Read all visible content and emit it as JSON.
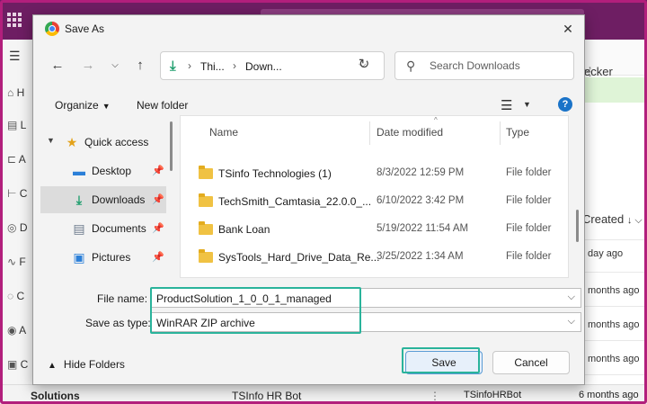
{
  "background": {
    "rail_items": [
      "H",
      "L",
      "A",
      "C",
      "D",
      "F",
      "C",
      "A",
      "C"
    ],
    "command_text": "ecker",
    "created_label": "Created",
    "rows": [
      "day ago",
      "months ago",
      "months ago",
      "months ago",
      "months ago"
    ],
    "bottom": {
      "solutions": "Solutions",
      "bot_name": "TSInfo HR Bot",
      "bot_id": "TSinfoHRBot",
      "age": "6 months ago"
    }
  },
  "dialog": {
    "title": "Save As",
    "address": {
      "crumb1": "Thi...",
      "crumb2": "Down..."
    },
    "search_placeholder": "Search Downloads",
    "toolbar": {
      "organize": "Organize",
      "new_folder": "New folder",
      "help": "?"
    },
    "nav": [
      {
        "label": "Quick access",
        "icon": "star-icon"
      },
      {
        "label": "Desktop",
        "icon": "desktop-icon"
      },
      {
        "label": "Downloads",
        "icon": "download-icon",
        "selected": true
      },
      {
        "label": "Documents",
        "icon": "documents-icon"
      },
      {
        "label": "Pictures",
        "icon": "pictures-icon"
      }
    ],
    "columns": {
      "name": "Name",
      "date": "Date modified",
      "type": "Type"
    },
    "files": [
      {
        "name": "TSinfo Technologies (1)",
        "date": "8/3/2022 12:59 PM",
        "type": "File folder"
      },
      {
        "name": "TechSmith_Camtasia_22.0.0_...",
        "date": "6/10/2022 3:42 PM",
        "type": "File folder"
      },
      {
        "name": "Bank Loan",
        "date": "5/19/2022 11:54 AM",
        "type": "File folder"
      },
      {
        "name": "SysTools_Hard_Drive_Data_Re...",
        "date": "3/25/2022 1:34 AM",
        "type": "File folder"
      }
    ],
    "file_name_label": "File name:",
    "file_name_value": "ProductSolution_1_0_0_1_managed",
    "save_type_label": "Save as type:",
    "save_type_value": "WinRAR ZIP archive",
    "hide_folders": "Hide Folders",
    "save_button": "Save",
    "cancel_button": "Cancel",
    "highlight_color": "#2ab39b",
    "frame_color": "#b21f7c"
  }
}
